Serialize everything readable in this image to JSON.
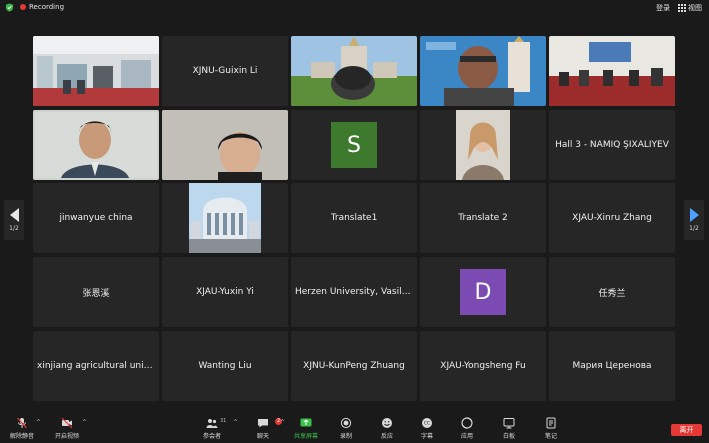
{
  "topbar": {
    "recording_label": "Recording",
    "login_label": "登录",
    "view_label": "视图"
  },
  "participants": [
    {
      "name": ""
    },
    {
      "name": "XJNU-Guixin Li"
    },
    {
      "name": ""
    },
    {
      "name": ""
    },
    {
      "name": ""
    },
    {
      "name": ""
    },
    {
      "name": ""
    },
    {
      "name": "",
      "avatar_letter": "S",
      "avatar_color": "#3d7a2e"
    },
    {
      "name": ""
    },
    {
      "name": "Hall 3 -  NAMIQ ŞIXALIYEV"
    },
    {
      "name": "jinwanyue  china"
    },
    {
      "name": ""
    },
    {
      "name": "Translate1"
    },
    {
      "name": "Translate 2"
    },
    {
      "name": "XJAU-Xinru Zhang"
    },
    {
      "name": "张恩溪"
    },
    {
      "name": "XJAU-Yuxin  Yi"
    },
    {
      "name": "Herzen University, Vasileostrovsky"
    },
    {
      "name": "",
      "avatar_letter": "D",
      "avatar_color": "#7b4bb3"
    },
    {
      "name": "任秀兰"
    },
    {
      "name": "xinjiang agricultural university"
    },
    {
      "name": "Wanting Liu"
    },
    {
      "name": "XJNU-KunPeng Zhuang"
    },
    {
      "name": "XJAU-Yongsheng Fu"
    },
    {
      "name": "Мария Церенова"
    }
  ],
  "pagination": {
    "left": "1/2",
    "right": "1/2"
  },
  "toolbar": {
    "unmute": "解除静音",
    "start_video": "开启视频",
    "participants": "参会者",
    "participants_count": "31",
    "chat": "聊天",
    "chat_badge": "2",
    "share": "共享屏幕",
    "record": "录制",
    "reactions": "反应",
    "captions": "字幕",
    "apps": "应用",
    "whiteboard": "白板",
    "notes": "笔记",
    "leave": "离开"
  },
  "colors": {
    "active_speaker": "#39c04a",
    "share_accent": "#39c04a",
    "leave_button": "#e53935"
  }
}
